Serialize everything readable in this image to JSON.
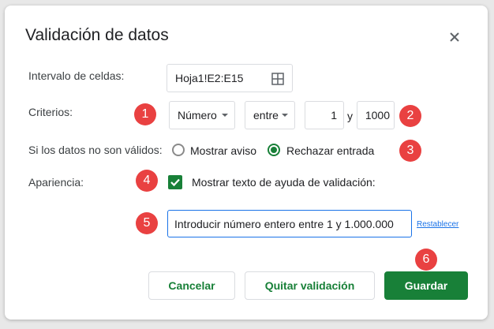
{
  "dialog": {
    "title": "Validación de datos"
  },
  "range": {
    "label": "Intervalo de celdas:",
    "value": "Hoja1!E2:E15"
  },
  "criteria": {
    "label": "Criterios:",
    "type_value": "Número",
    "operator_value": "entre",
    "min_value": "1",
    "between_word": "y",
    "max_value": "1000"
  },
  "invalid": {
    "label": "Si los datos no son válidos:",
    "option_warning": "Mostrar aviso",
    "option_reject": "Rechazar entrada",
    "selected": "Rechazar entrada"
  },
  "appearance": {
    "label": "Apariencia:",
    "checkbox_label": "Mostrar texto de ayuda de validación:",
    "checked": true,
    "help_text": "Introducir número entero entre 1 y 1.000.000",
    "reset_label": "Restablecer"
  },
  "buttons": {
    "cancel": "Cancelar",
    "remove": "Quitar validación",
    "save": "Guardar"
  },
  "badges": [
    "1",
    "2",
    "3",
    "4",
    "5",
    "6"
  ],
  "colors": {
    "accent": "#188038",
    "badge": "#e94141",
    "link": "#1a73e8"
  }
}
